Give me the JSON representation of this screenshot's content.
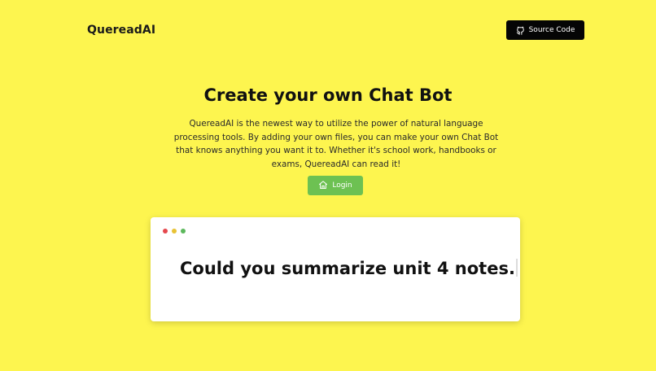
{
  "header": {
    "brand": "QuereadAI",
    "source_button_label": "Source Code",
    "source_button_icon": "github-icon"
  },
  "hero": {
    "title": "Create your own Chat Bot",
    "description": "QuereadAI is the newest way to utilize the power of natural language processing tools. By adding your own files, you can make your own Chat Bot that knows anything you want it to. Whether it's school work, handbooks or exams, QuereadAI can read it!",
    "login_label": "Login",
    "login_icon": "home-icon"
  },
  "demo": {
    "typed_text": "Could you summarize unit 4 notes.",
    "window_dots": [
      "#e5484d",
      "#e8c235",
      "#5cb85c"
    ]
  },
  "colors": {
    "background": "#fdf54f",
    "source_button": "#050505",
    "login_button": "#6dc152"
  }
}
